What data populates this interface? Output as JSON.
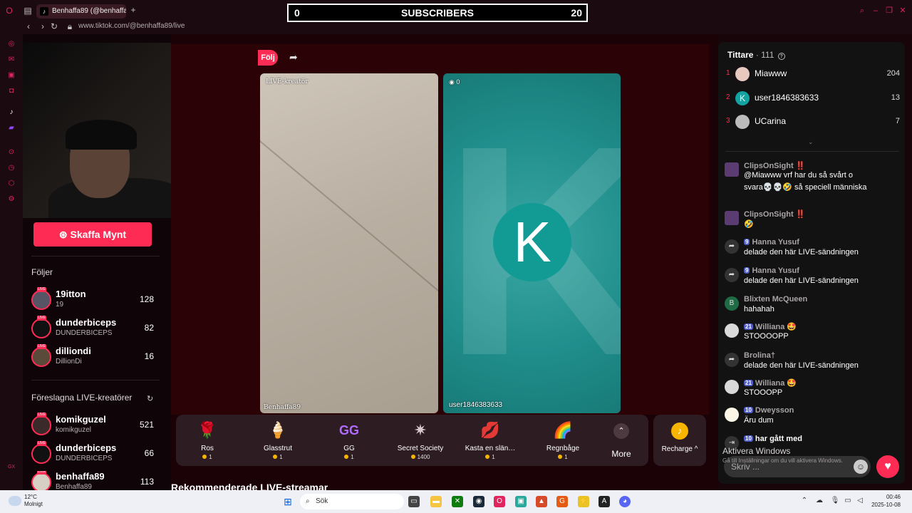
{
  "browser": {
    "tab_title": "Benhaffa89 (@benhaffa",
    "url_prefix": "www.tiktok.com",
    "url_path": "/@benhaffa89/live"
  },
  "overlay": {
    "left_count": "0",
    "label": "SUBSCRIBERS",
    "right_count": "20"
  },
  "left": {
    "coins_button": "Skaffa Mynt",
    "following_title": "Följer",
    "following": [
      {
        "name": "19itton",
        "handle": "19",
        "count": "128"
      },
      {
        "name": "dunderbiceps",
        "handle": "DUNDERBICEPS",
        "count": "82"
      },
      {
        "name": "dilliondi",
        "handle": "DillionDi",
        "count": "16"
      }
    ],
    "suggested_title": "Föreslagna LIVE-kreatörer",
    "suggested": [
      {
        "name": "komikguzel",
        "handle": "komikguzel",
        "count": "521"
      },
      {
        "name": "dunderbiceps",
        "handle": "DUNDERBICEPS",
        "count": "66"
      },
      {
        "name": "benhaffa89",
        "handle": "Benhaffa89",
        "count": "113"
      }
    ],
    "live_badge": "LIVE"
  },
  "stream": {
    "follow_label": "Följ",
    "left_panel_tag": "LIVE-kreatör",
    "left_panel_name": "Benhaffa89",
    "right_panel_score": "0",
    "right_panel_name": "user1846383633",
    "right_panel_letter": "K",
    "recommended_title": "Rekommenderade LIVE-streamar"
  },
  "gifts": [
    {
      "icon": "🌹",
      "name": "Ros",
      "price": "1"
    },
    {
      "icon": "🍦",
      "name": "Glasstrut",
      "price": "1"
    },
    {
      "icon": "GG",
      "name": "GG",
      "price": "1"
    },
    {
      "icon": "✷",
      "name": "Secret Society",
      "price": "1400"
    },
    {
      "icon": "💋",
      "name": "Kasta en slän…",
      "price": "1"
    },
    {
      "icon": "🌈",
      "name": "Regnbåge",
      "price": "1"
    }
  ],
  "gift_more": "More",
  "recharge": "Recharge ^",
  "chat": {
    "viewers_title": "Tittare",
    "viewers_count": "· 111",
    "top_viewers": [
      {
        "rank": "1",
        "name": "Miawww",
        "score": "204"
      },
      {
        "rank": "2",
        "name": "user1846383633",
        "score": "13"
      },
      {
        "rank": "3",
        "name": "UCarina",
        "score": "7"
      }
    ],
    "messages": [
      {
        "user": "ClipsOnSight ‼️",
        "badge": "",
        "text": "@Miawww vrf har du så svårt o",
        "text2": "svara💀💀🤣 så speciell människa"
      },
      {
        "user": "ClipsOnSight ‼️",
        "badge": "",
        "text": "🤣",
        "text2": ""
      },
      {
        "user": "Hanna Yusuf",
        "badge": "9",
        "text": "delade den här LIVE-sändningen",
        "text2": ""
      },
      {
        "user": "Hanna Yusuf",
        "badge": "9",
        "text": "delade den här LIVE-sändningen",
        "text2": ""
      },
      {
        "user": "Blixten McQueen",
        "badge": "",
        "text": "hahahah",
        "text2": ""
      },
      {
        "user": "Williana 🤩",
        "badge": "21",
        "text": "STOOOOPP",
        "text2": ""
      },
      {
        "user": "Brolina†",
        "badge": "",
        "text": "delade den här LIVE-sändningen",
        "text2": ""
      },
      {
        "user": "Williana 🤩",
        "badge": "21",
        "text": "STOOOPP",
        "text2": ""
      },
      {
        "user": "Dweysson",
        "badge": "10",
        "text": "Äru dum",
        "text2": ""
      },
      {
        "user": "",
        "badge": "10",
        "text": "har gått med",
        "text2": ""
      }
    ],
    "input_placeholder": "Skriv ...",
    "activate_title": "Aktivera Windows",
    "activate_sub": "Gå till Inställningar om du vill aktivera Windows."
  },
  "taskbar": {
    "weather_temp": "12°C",
    "weather_desc": "Molnigt",
    "search_label": "Sök",
    "time": "00:46",
    "date": "2025-10-08"
  }
}
